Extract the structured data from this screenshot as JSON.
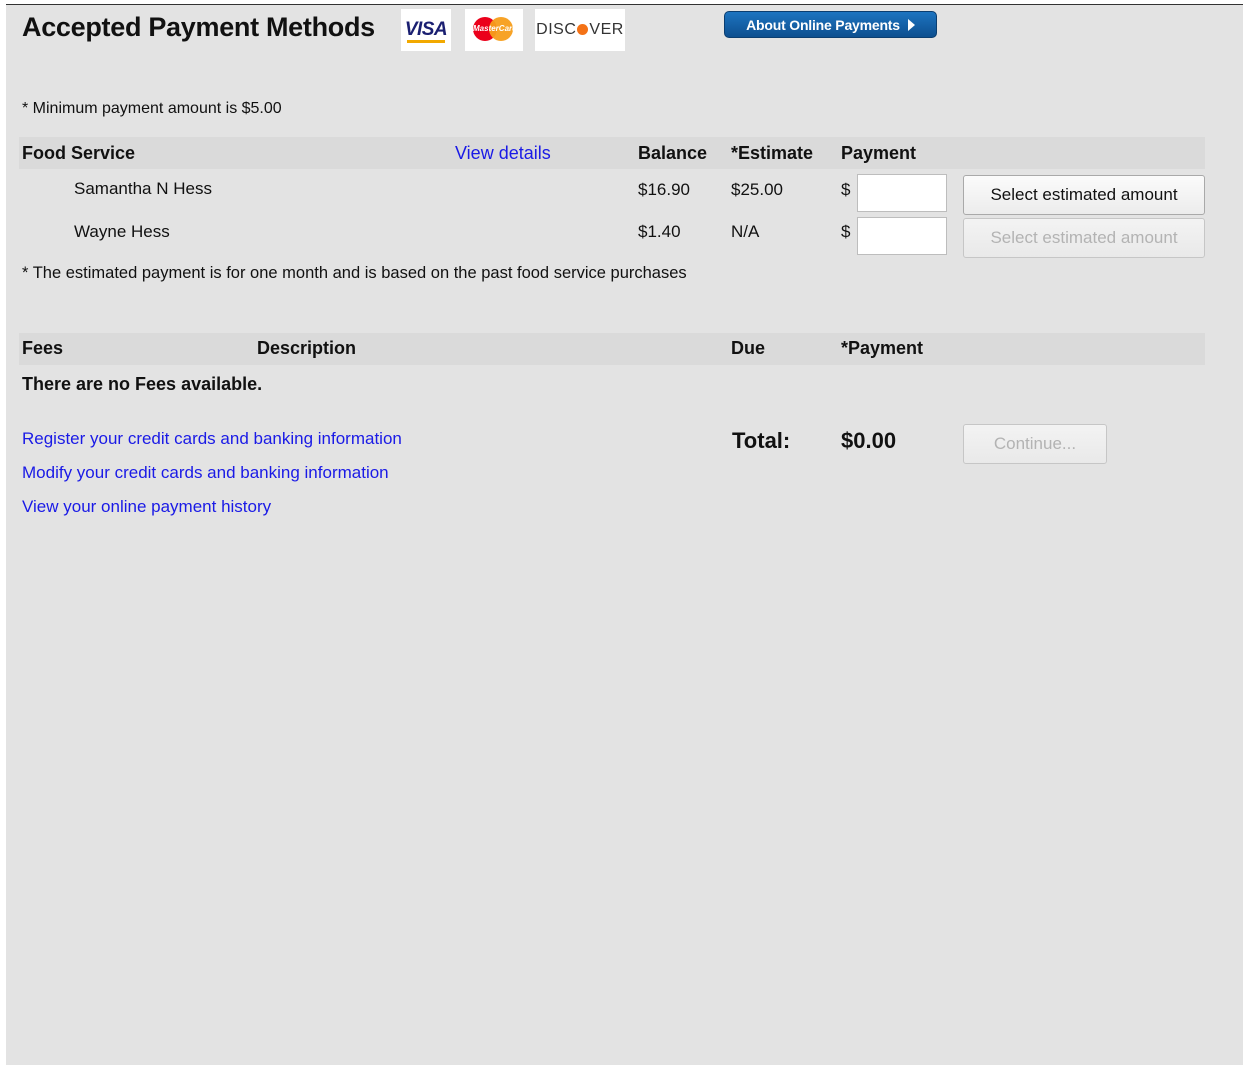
{
  "header": {
    "title": "Accepted Payment Methods",
    "cards": {
      "visa": "VISA",
      "mastercard": "MasterCard",
      "discover_prefix": "DISC",
      "discover_suffix": "VER"
    },
    "about_button": "About Online Payments"
  },
  "notes": {
    "minimum": "* Minimum payment amount is $5.00",
    "estimate_note": "* The estimated payment is for one month and is based on the past food service purchases"
  },
  "food_service": {
    "heading": "Food Service",
    "view_details": "View details",
    "columns": {
      "balance": "Balance",
      "estimate": "*Estimate",
      "payment": "Payment"
    },
    "rows": [
      {
        "name": "Samantha N Hess",
        "balance": "$16.90",
        "estimate": "$25.00",
        "currency": "$",
        "payment_value": "",
        "select_button": "Select estimated amount",
        "select_enabled": true
      },
      {
        "name": "Wayne Hess",
        "balance": "$1.40",
        "estimate": "N/A",
        "currency": "$",
        "payment_value": "",
        "select_button": "Select estimated amount",
        "select_enabled": false
      }
    ]
  },
  "fees": {
    "columns": {
      "fees": "Fees",
      "description": "Description",
      "due": "Due",
      "payment": "*Payment"
    },
    "empty_message": "There are no Fees available."
  },
  "links": {
    "register": "Register your credit cards and banking information",
    "modify": "Modify your credit cards and banking information",
    "history": "View your online payment history"
  },
  "total": {
    "label": "Total:",
    "amount": "$0.00",
    "continue_button": "Continue..."
  },
  "colors": {
    "panel_bg": "#e3e3e3",
    "link": "#1a1ae6",
    "about_button": "#1d74c0"
  }
}
